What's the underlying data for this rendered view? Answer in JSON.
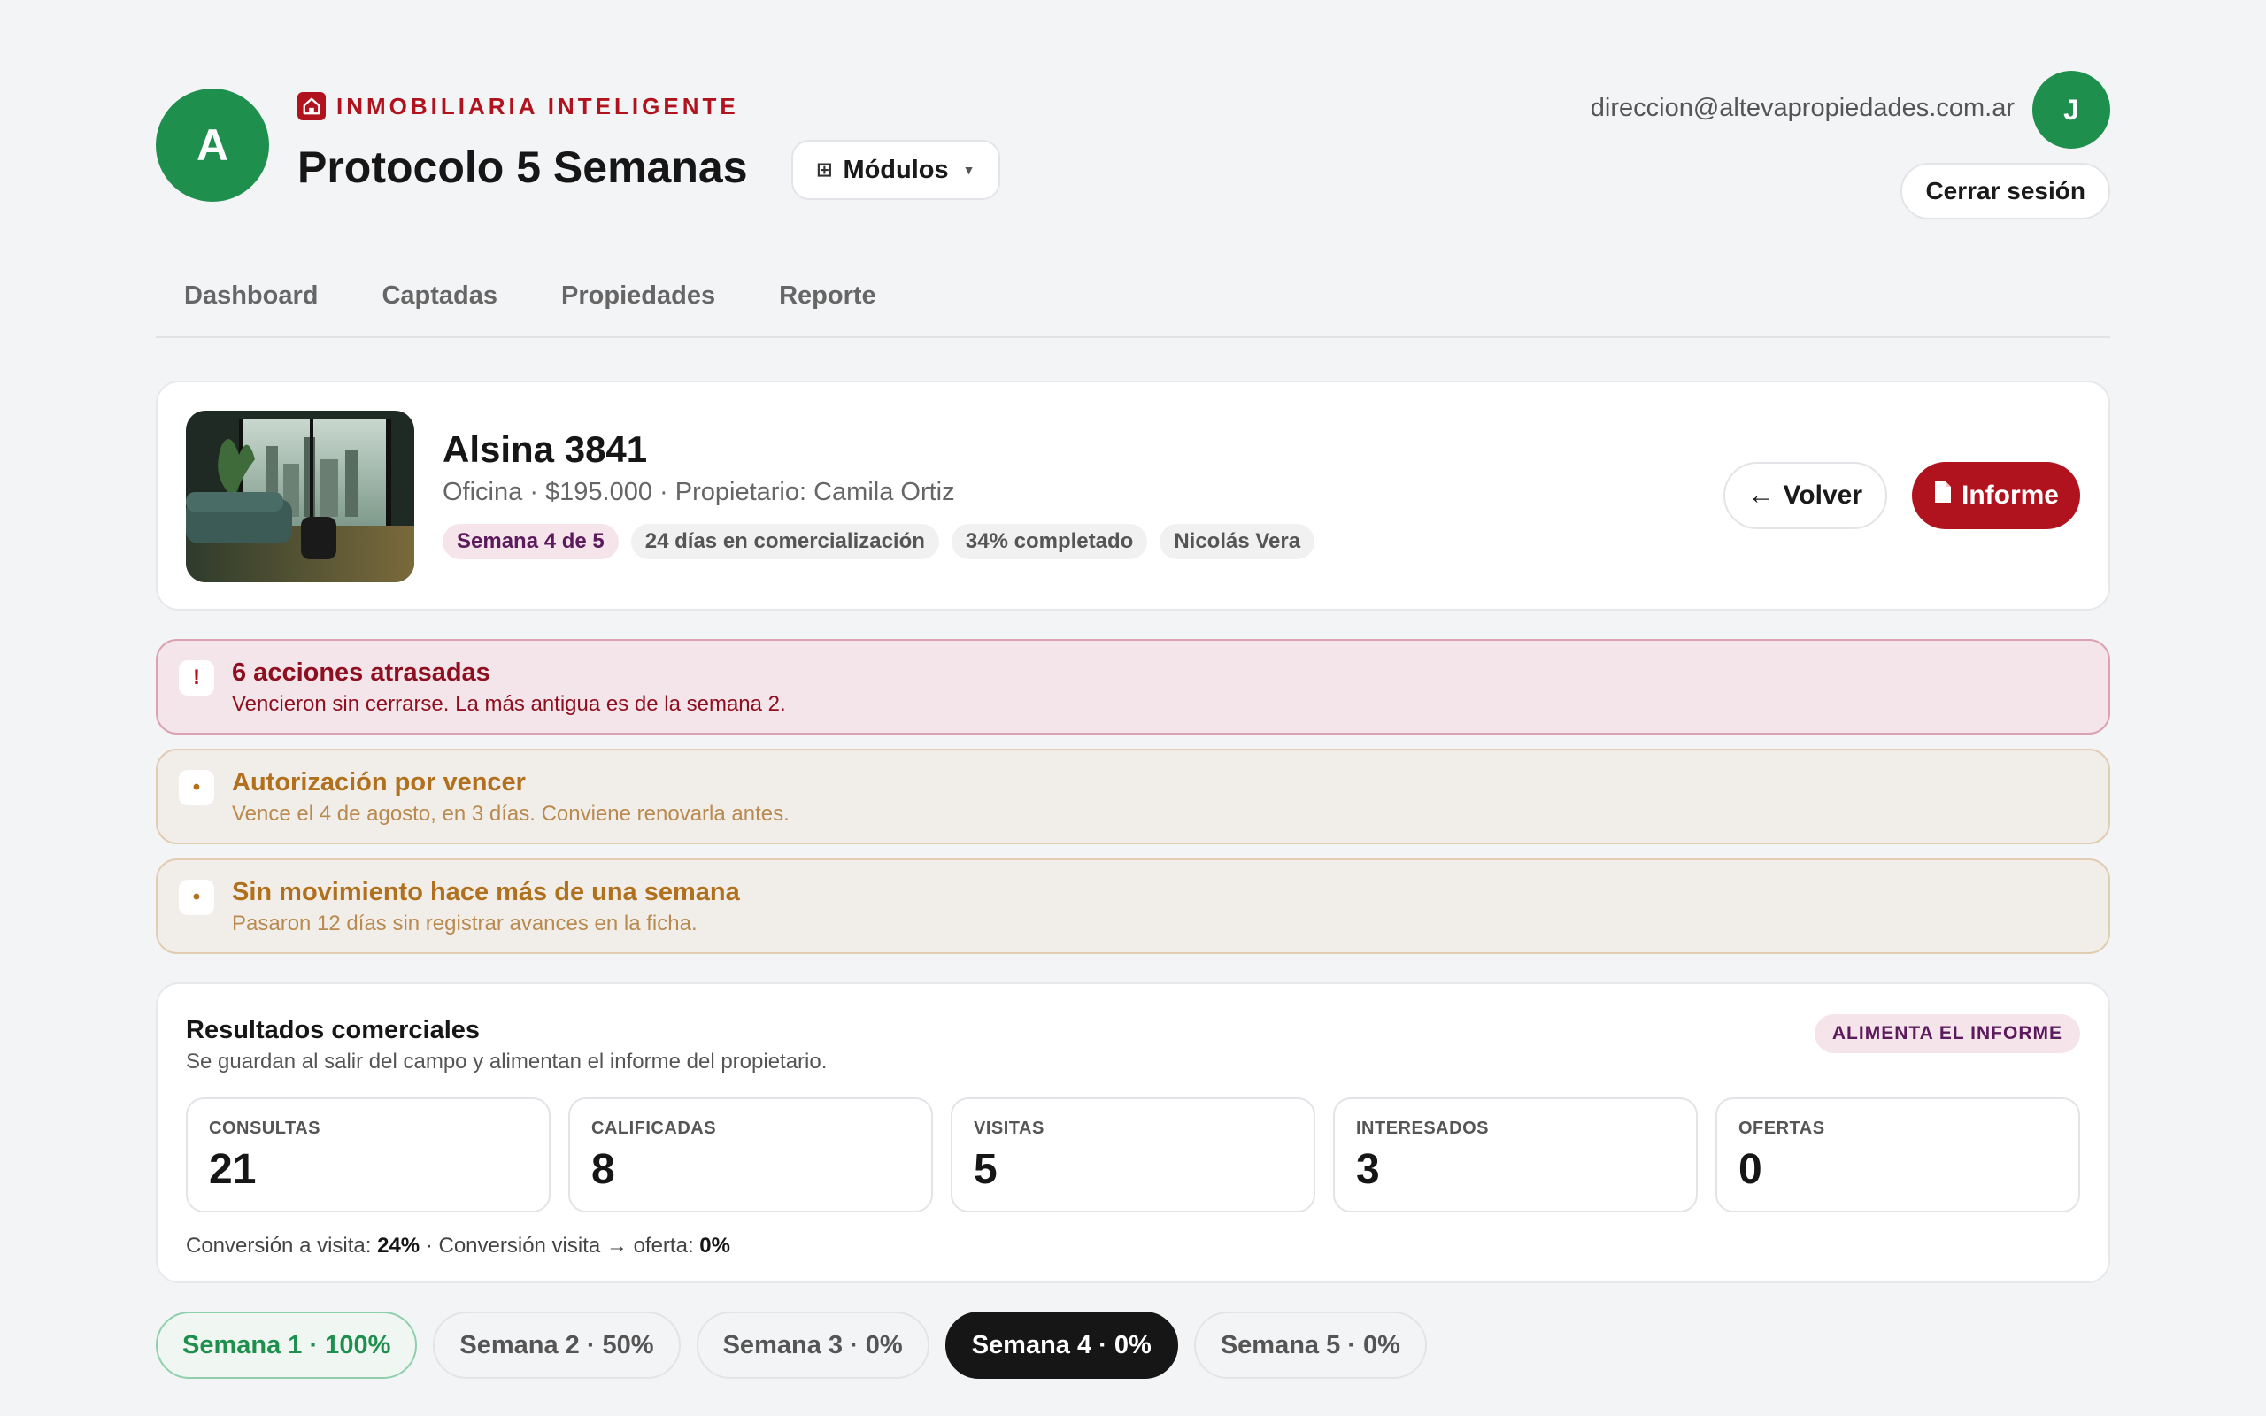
{
  "header": {
    "logo_letter": "A",
    "brand": "INMOBILIARIA INTELIGENTE",
    "title": "Protocolo 5 Semanas",
    "modules_label": "Módulos",
    "user_email": "direccion@altevapropiedades.com.ar",
    "user_initial": "J",
    "logout_label": "Cerrar sesión"
  },
  "nav": {
    "tabs": [
      "Dashboard",
      "Captadas",
      "Propiedades",
      "Reporte"
    ]
  },
  "property": {
    "name": "Alsina 3841",
    "subtitle": "Oficina · $195.000 · Propietario: Camila Ortiz",
    "chips": [
      "Semana 4 de 5",
      "24 días en comercialización",
      "34% completado",
      "Nicolás Vera"
    ],
    "back_label": "Volver",
    "report_label": "Informe"
  },
  "alerts": [
    {
      "icon": "!",
      "title": "6 acciones atrasadas",
      "desc": "Vencieron sin cerrarse. La más antigua es de la semana 2."
    },
    {
      "icon": "•",
      "title": "Autorización por vencer",
      "desc": "Vence el 4 de agosto, en 3 días. Conviene renovarla antes."
    },
    {
      "icon": "•",
      "title": "Sin movimiento hace más de una semana",
      "desc": "Pasaron 12 días sin registrar avances en la ficha."
    }
  ],
  "results": {
    "title": "Resultados comerciales",
    "subtitle": "Se guardan al salir del campo y alimentan el informe del propietario.",
    "badge": "ALIMENTA EL INFORME",
    "metrics": [
      {
        "label": "CONSULTAS",
        "value": "21"
      },
      {
        "label": "CALIFICADAS",
        "value": "8"
      },
      {
        "label": "VISITAS",
        "value": "5"
      },
      {
        "label": "INTERESADOS",
        "value": "3"
      },
      {
        "label": "OFERTAS",
        "value": "0"
      }
    ],
    "conv_visit_label": "Conversión a visita:",
    "conv_visit_value": "24%",
    "conv_offer_label": "· Conversión visita → oferta:",
    "conv_offer_value": "0%"
  },
  "weeks": [
    "Semana 1 · 100%",
    "Semana 2 · 50%",
    "Semana 3 · 0%",
    "Semana 4 · 0%",
    "Semana 5 · 0%"
  ],
  "colors": {
    "brand_red": "#b0121e",
    "brand_green": "#1f8f4e",
    "danger_bg": "#f3e5ea",
    "warn_bg": "#f1eee9",
    "accent_purple": "#5b1a5c"
  }
}
